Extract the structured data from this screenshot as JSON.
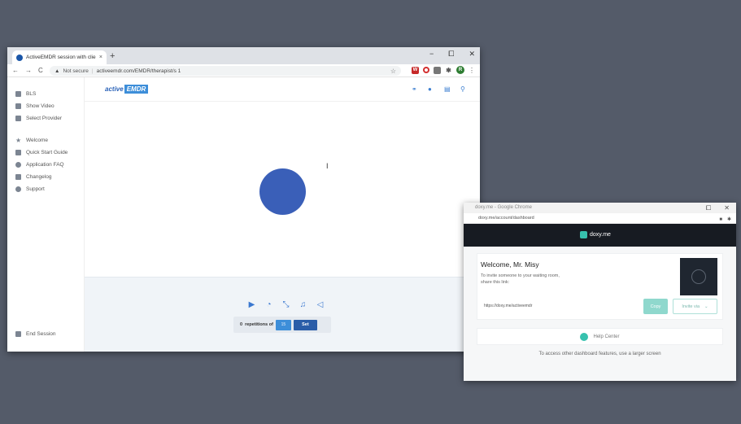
{
  "main_window": {
    "tab_title": "ActiveEMDR session with client",
    "tab_close": "×",
    "new_tab": "+",
    "window_controls": [
      "−",
      "⧠",
      "✕"
    ],
    "address": {
      "security": "Not secure",
      "url": "activeemdr.com/EMDR/therapist/s 1"
    },
    "extension_badges": {
      "red": "W",
      "profile": "R"
    }
  },
  "sidebar": {
    "group1": [
      {
        "label": "BLS"
      },
      {
        "label": "Show Video"
      },
      {
        "label": "Select Provider"
      }
    ],
    "group2": [
      {
        "label": "Welcome"
      },
      {
        "label": "Quick Start Guide"
      },
      {
        "label": "Application FAQ"
      },
      {
        "label": "Changelog"
      },
      {
        "label": "Support"
      }
    ],
    "end_session": "End Session"
  },
  "app_header": {
    "logo_part1": "active",
    "logo_part2": "EMDR"
  },
  "controls": {
    "repetitions_count": "0",
    "repetitions_label": "repetitions of",
    "repetitions_input": "15",
    "set_button": "Set"
  },
  "doxy_window": {
    "title": "doxy.me - Google Chrome",
    "url": "doxy.me/account/dashboard",
    "brand": "doxy.me",
    "welcome": "Welcome, Mr. Misy",
    "invite_line1": "To invite someone to your waiting room,",
    "invite_line2": "share this link:",
    "room_url": "https://doxy.me/activeemdr",
    "copy_button": "Copy",
    "invite_button": "Invite via",
    "help_center": "Help Center",
    "notice": "To access other dashboard features, use a larger screen"
  },
  "colors": {
    "accent_blue": "#3d8ed9",
    "ball_blue": "#3a5fb8",
    "doxy_teal": "#37c1ae",
    "desktop": "#545b69"
  }
}
